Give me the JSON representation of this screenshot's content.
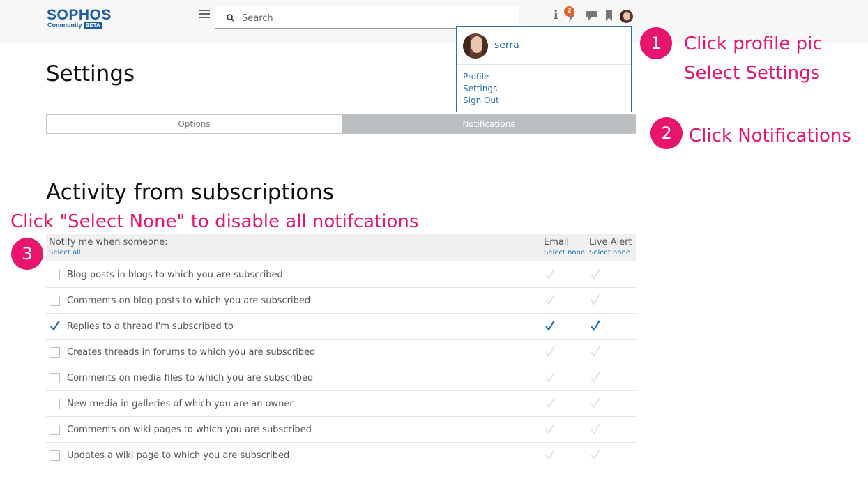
{
  "header": {
    "logo_text": "SOPHOS",
    "logo_sub": "Community",
    "logo_badge": "BETA",
    "search_placeholder": "Search",
    "notification_count": "2"
  },
  "user_menu": {
    "username": "serra",
    "items": [
      {
        "label": "Profile"
      },
      {
        "label": "Settings"
      },
      {
        "label": "Sign Out"
      }
    ]
  },
  "page": {
    "title": "Settings",
    "tabs": [
      {
        "label": "Options",
        "active": false
      },
      {
        "label": "Notifications",
        "active": true
      }
    ],
    "section_title": "Activity from subscriptions"
  },
  "table": {
    "header_label": "Notify me when someone:",
    "select_all": "Select all",
    "columns": [
      {
        "label": "Email",
        "select_none": "Select none"
      },
      {
        "label": "Live Alert",
        "select_none": "Select none"
      }
    ],
    "rows": [
      {
        "label": "Blog posts in blogs to which you are subscribed",
        "checked": false,
        "email": false,
        "live": false
      },
      {
        "label": "Comments on blog posts to which you are subscribed",
        "checked": false,
        "email": false,
        "live": false
      },
      {
        "label": "Replies to a thread I'm subscribed to",
        "checked": true,
        "email": true,
        "live": true
      },
      {
        "label": "Creates threads in forums to which you are subscribed",
        "checked": false,
        "email": false,
        "live": false
      },
      {
        "label": "Comments on media files to which you are subscribed",
        "checked": false,
        "email": false,
        "live": false
      },
      {
        "label": "New media in galleries of which you are an owner",
        "checked": false,
        "email": false,
        "live": false
      },
      {
        "label": "Comments on wiki pages to which you are subscribed",
        "checked": false,
        "email": false,
        "live": false
      },
      {
        "label": "Updates a wiki page to which you are subscribed",
        "checked": false,
        "email": false,
        "live": false
      }
    ]
  },
  "annotations": {
    "step1_num": "1",
    "step1_line1": "Click profile pic",
    "step1_line2": "Select Settings",
    "step2_num": "2",
    "step2_text": "Click Notifications",
    "step3_num": "3",
    "step3_text": "Click \"Select None\" to disable all notifcations"
  },
  "colors": {
    "brand": "#1a5ca8",
    "link": "#1f6fb5",
    "annotation": "#e8156e",
    "badge": "#e8632a",
    "tab_active": "#bcbfc2"
  }
}
